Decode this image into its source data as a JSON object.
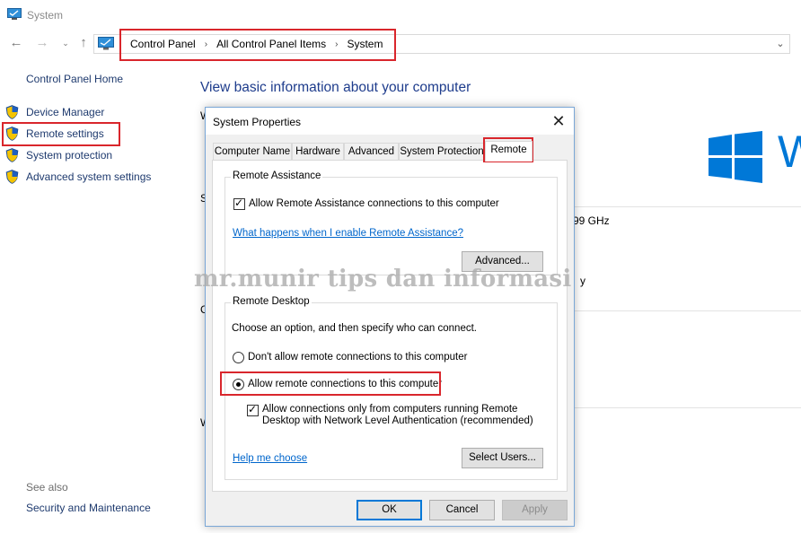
{
  "window": {
    "title": "System"
  },
  "address": {
    "crumbs": [
      "Control Panel",
      "All Control Panel Items",
      "System"
    ]
  },
  "nav": {
    "back_icon": "back-arrow-icon",
    "forward_icon": "forward-arrow-icon",
    "recent_icon": "chevron-down-icon",
    "up_icon": "up-arrow-icon"
  },
  "sidebar": {
    "home": "Control Panel Home",
    "items": [
      {
        "label": "Device Manager",
        "icon": "shield-icon"
      },
      {
        "label": "Remote settings",
        "icon": "shield-icon"
      },
      {
        "label": "System protection",
        "icon": "shield-icon"
      },
      {
        "label": "Advanced system settings",
        "icon": "shield-icon"
      }
    ],
    "see_also": "See also",
    "see_also_items": [
      "Security and Maintenance"
    ]
  },
  "main": {
    "title": "View basic information about your computer",
    "partial_letters": [
      "W",
      "S",
      "C",
      "W"
    ],
    "ghz_text": "99 GHz",
    "y_text": "y",
    "windows_text": "W"
  },
  "watermark": "mr.munir tips dan informasi",
  "dialog": {
    "title": "System Properties",
    "tabs": [
      "Computer Name",
      "Hardware",
      "Advanced",
      "System Protection",
      "Remote"
    ],
    "active_tab": "Remote",
    "remote_assistance": {
      "group_label": "Remote Assistance",
      "allow_label": "Allow Remote Assistance connections to this computer",
      "allow_checked": true,
      "help_link": "What happens when I enable Remote Assistance?",
      "advanced_button": "Advanced..."
    },
    "remote_desktop": {
      "group_label": "Remote Desktop",
      "instruction": "Choose an option, and then specify who can connect.",
      "option_dont_allow": "Don't allow remote connections to this computer",
      "option_allow": "Allow remote connections to this computer",
      "selected_option": "allow",
      "nla_label_line1": "Allow connections only from computers running Remote",
      "nla_label_line2": "Desktop with Network Level Authentication (recommended)",
      "nla_checked": true,
      "help_link": "Help me choose",
      "select_users_button": "Select Users..."
    },
    "buttons": {
      "ok": "OK",
      "cancel": "Cancel",
      "apply": "Apply"
    }
  },
  "colors": {
    "highlight_red": "#d9262c",
    "link_blue": "#0066cc",
    "windows_blue": "#0078d7",
    "sidebar_link": "#1e3a6e"
  }
}
